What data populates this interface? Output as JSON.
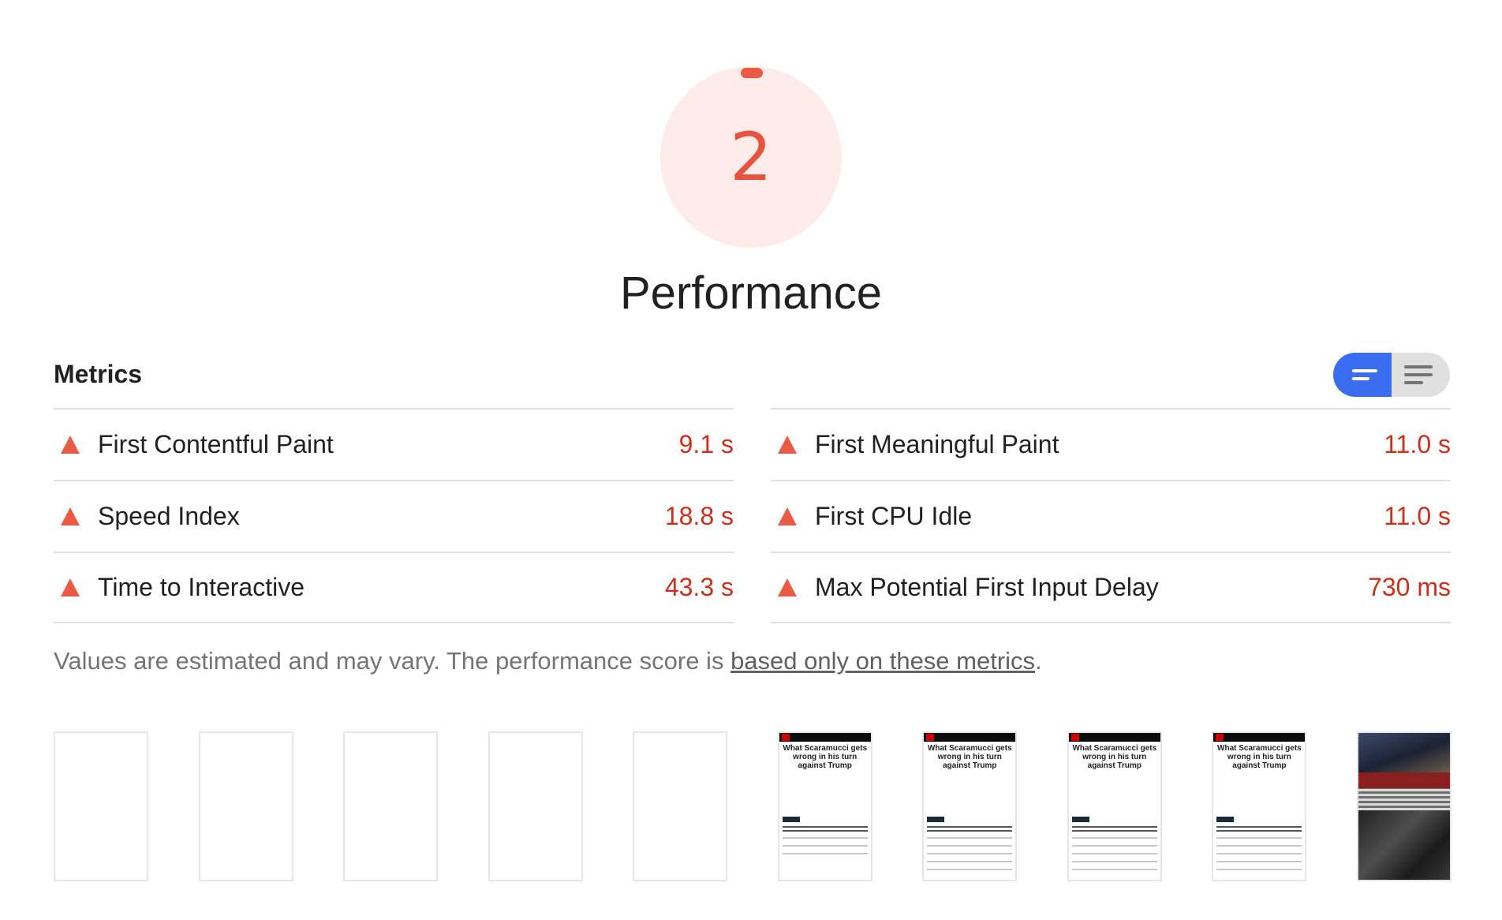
{
  "gauge": {
    "score": "2",
    "color": "#eb5a45",
    "score_fraction": 0.02
  },
  "category": {
    "title": "Performance"
  },
  "metrics": {
    "title": "Metrics",
    "toggle": {
      "compact_icon": "compact-view-icon",
      "expanded_icon": "expanded-view-icon",
      "active": "compact"
    },
    "items": [
      {
        "label": "First Contentful Paint",
        "value": "9.1 s",
        "status": "fail"
      },
      {
        "label": "First Meaningful Paint",
        "value": "11.0 s",
        "status": "fail"
      },
      {
        "label": "Speed Index",
        "value": "18.8 s",
        "status": "fail"
      },
      {
        "label": "First CPU Idle",
        "value": "11.0 s",
        "status": "fail"
      },
      {
        "label": "Time to Interactive",
        "value": "43.3 s",
        "status": "fail"
      },
      {
        "label": "Max Potential First Input Delay",
        "value": "730 ms",
        "status": "fail"
      }
    ],
    "footnote": {
      "prefix": "Values are estimated and may vary. The performance score is ",
      "link": "based only on these metrics",
      "suffix": "."
    }
  },
  "filmstrip": {
    "frames": [
      {
        "type": "blank"
      },
      {
        "type": "blank"
      },
      {
        "type": "blank"
      },
      {
        "type": "blank"
      },
      {
        "type": "blank"
      },
      {
        "type": "article",
        "headline": "What Scaramucci gets wrong in his turn against Trump"
      },
      {
        "type": "article",
        "headline": "What Scaramucci gets wrong in his turn against Trump"
      },
      {
        "type": "article",
        "headline": "What Scaramucci gets wrong in his turn against Trump"
      },
      {
        "type": "article",
        "headline": "What Scaramucci gets wrong in his turn against Trump"
      },
      {
        "type": "photo"
      }
    ]
  }
}
